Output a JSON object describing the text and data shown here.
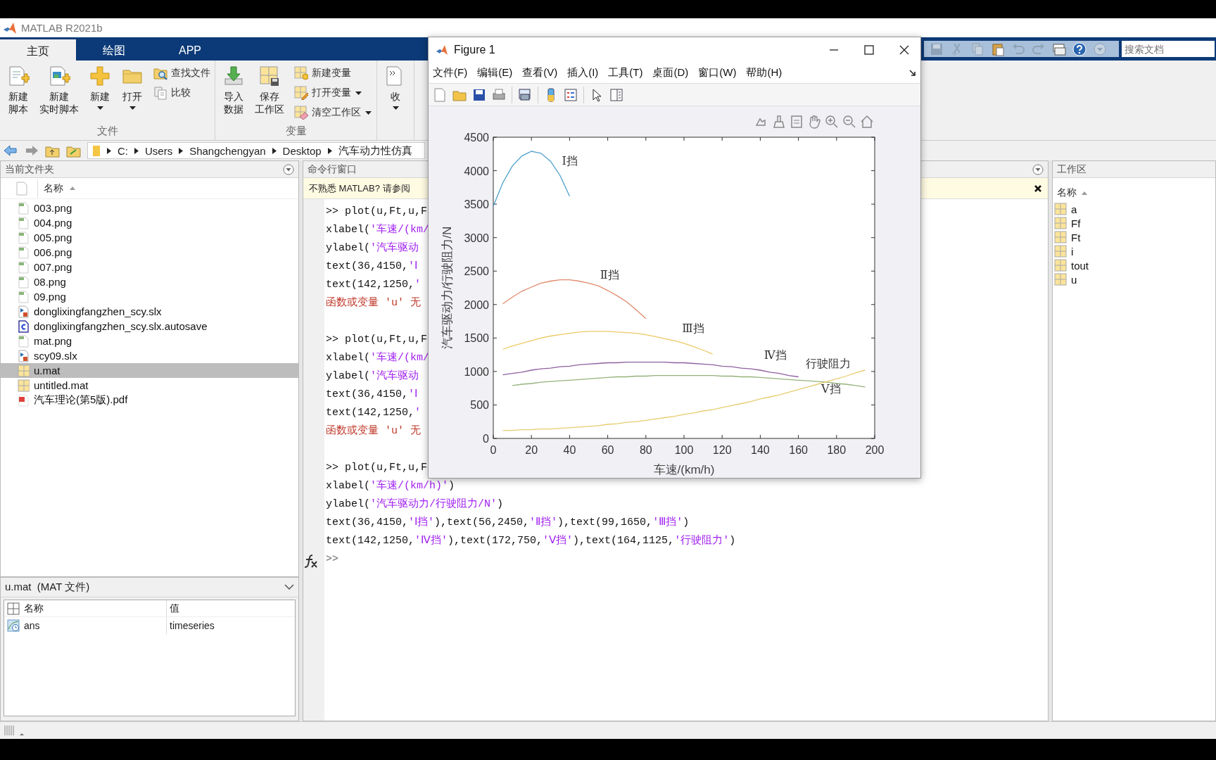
{
  "app": {
    "title": "MATLAB R2021b"
  },
  "ribbon": {
    "tabs": [
      {
        "label": "主页",
        "selected": true
      },
      {
        "label": "绘图",
        "selected": false
      },
      {
        "label": "APP",
        "selected": false
      }
    ],
    "groups": [
      {
        "label": "文件",
        "buttons": [
          {
            "kind": "large",
            "label": [
              "新建",
              "脚本"
            ],
            "dropdown": false
          },
          {
            "kind": "large",
            "label": [
              "新建",
              "实时脚本"
            ],
            "dropdown": false
          },
          {
            "kind": "large",
            "label": [
              "新建"
            ],
            "dropdown": true
          },
          {
            "kind": "large",
            "label": [
              "打开"
            ],
            "dropdown": true
          },
          {
            "kind": "small",
            "label": "查找文件",
            "dropdown": false
          },
          {
            "kind": "small",
            "label": "比较",
            "dropdown": false
          }
        ]
      },
      {
        "label": "变量",
        "buttons": [
          {
            "kind": "large",
            "label": [
              "导入",
              "数据"
            ],
            "dropdown": false
          },
          {
            "kind": "large",
            "label": [
              "保存",
              "工作区"
            ],
            "dropdown": false
          },
          {
            "kind": "small",
            "label": "新建变量",
            "dropdown": false
          },
          {
            "kind": "small",
            "label": "打开变量",
            "dropdown": true
          },
          {
            "kind": "small",
            "label": "清空工作区",
            "dropdown": true
          }
        ]
      },
      {
        "buttons": [
          {
            "kind": "large",
            "label": [
              "收"
            ],
            "dropdown": true
          }
        ]
      }
    ],
    "search": {
      "placeholder": "搜索文档"
    }
  },
  "address_bar": {
    "path": [
      "C:",
      "Users",
      "Shangchengyan",
      "Desktop",
      "汽车动力性仿真"
    ]
  },
  "file_browser": {
    "title": "当前文件夹",
    "column": "名称",
    "files": [
      {
        "name": "003.png",
        "kind": "png",
        "selected": false
      },
      {
        "name": "004.png",
        "kind": "png",
        "selected": false
      },
      {
        "name": "005.png",
        "kind": "png",
        "selected": false
      },
      {
        "name": "006.png",
        "kind": "png",
        "selected": false
      },
      {
        "name": "007.png",
        "kind": "png",
        "selected": false
      },
      {
        "name": "08.png",
        "kind": "png",
        "selected": false
      },
      {
        "name": "09.png",
        "kind": "png",
        "selected": false
      },
      {
        "name": "donglixingfangzhen_scy.slx",
        "kind": "slx",
        "selected": false
      },
      {
        "name": "donglixingfangzhen_scy.slx.autosave",
        "kind": "autosave",
        "selected": false
      },
      {
        "name": "mat.png",
        "kind": "png",
        "selected": false
      },
      {
        "name": "scy09.slx",
        "kind": "slx",
        "selected": false
      },
      {
        "name": "u.mat",
        "kind": "mat",
        "selected": true
      },
      {
        "name": "untitled.mat",
        "kind": "mat",
        "selected": false
      },
      {
        "name": "汽车理论(第5版).pdf",
        "kind": "pdf",
        "selected": false
      }
    ]
  },
  "details": {
    "title": "u.mat  (MAT 文件)",
    "columns": [
      "名称",
      "值"
    ],
    "rows": [
      {
        "name": "ans",
        "value": "timeseries"
      }
    ]
  },
  "command_window": {
    "title": "命令行窗口",
    "banner": "不熟悉 MATLAB? 请参阅",
    "blocks": [
      [
        {
          "segments": [
            {
              "kind": "code",
              "text": ">> plot(u,Ft,u,F"
            }
          ]
        },
        {
          "segments": [
            {
              "kind": "code",
              "text": "xlabel("
            },
            {
              "kind": "string",
              "text": "'车速/(km/"
            }
          ]
        },
        {
          "segments": [
            {
              "kind": "code",
              "text": "ylabel("
            },
            {
              "kind": "string",
              "text": "'汽车驱动"
            }
          ]
        },
        {
          "segments": [
            {
              "kind": "code",
              "text": "text(36,4150,"
            },
            {
              "kind": "string",
              "text": "'Ⅰ"
            }
          ]
        },
        {
          "segments": [
            {
              "kind": "code",
              "text": "text(142,1250,"
            },
            {
              "kind": "string",
              "text": "'"
            }
          ]
        },
        {
          "segments": [
            {
              "kind": "error",
              "text": "函数或变量 'u' 无"
            }
          ]
        }
      ],
      [
        {
          "segments": [
            {
              "kind": "code",
              "text": ">> plot(u,Ft,u,F"
            }
          ]
        },
        {
          "segments": [
            {
              "kind": "code",
              "text": "xlabel("
            },
            {
              "kind": "string",
              "text": "'车速/(km/"
            }
          ]
        },
        {
          "segments": [
            {
              "kind": "code",
              "text": "ylabel("
            },
            {
              "kind": "string",
              "text": "'汽车驱动"
            }
          ]
        },
        {
          "segments": [
            {
              "kind": "code",
              "text": "text(36,4150,"
            },
            {
              "kind": "string",
              "text": "'Ⅰ"
            }
          ]
        },
        {
          "segments": [
            {
              "kind": "code",
              "text": "text(142,1250,"
            },
            {
              "kind": "string",
              "text": "'"
            }
          ]
        },
        {
          "segments": [
            {
              "kind": "error",
              "text": "函数或变量 'u' 无"
            }
          ]
        }
      ],
      [
        {
          "segments": [
            {
              "kind": "code",
              "text": ">> plot(u,Ft,u,F"
            }
          ]
        },
        {
          "segments": [
            {
              "kind": "code",
              "text": "xlabel("
            },
            {
              "kind": "string",
              "text": "'车速/(km/h)'"
            },
            {
              "kind": "code",
              "text": ")"
            }
          ]
        },
        {
          "segments": [
            {
              "kind": "code",
              "text": "ylabel("
            },
            {
              "kind": "string",
              "text": "'汽车驱动力/行驶阻力/N'"
            },
            {
              "kind": "code",
              "text": ")"
            }
          ]
        },
        {
          "segments": [
            {
              "kind": "code",
              "text": "text(36,4150,"
            },
            {
              "kind": "string",
              "text": "'Ⅰ挡'"
            },
            {
              "kind": "code",
              "text": "),text(56,2450,"
            },
            {
              "kind": "string",
              "text": "'Ⅱ挡'"
            },
            {
              "kind": "code",
              "text": "),text(99,1650,"
            },
            {
              "kind": "string",
              "text": "'Ⅲ挡'"
            },
            {
              "kind": "code",
              "text": ")"
            }
          ]
        },
        {
          "segments": [
            {
              "kind": "code",
              "text": "text(142,1250,"
            },
            {
              "kind": "string",
              "text": "'Ⅳ挡'"
            },
            {
              "kind": "code",
              "text": "),text(172,750,"
            },
            {
              "kind": "string",
              "text": "'Ⅴ挡'"
            },
            {
              "kind": "code",
              "text": "),text(164,1125,"
            },
            {
              "kind": "string",
              "text": "'行驶阻力'"
            },
            {
              "kind": "code",
              "text": ")"
            }
          ]
        }
      ]
    ],
    "prompt": ">>"
  },
  "workspace": {
    "title": "工作区",
    "column": "名称",
    "variables": [
      "a",
      "Ff",
      "Ft",
      "i",
      "tout",
      "u"
    ]
  },
  "figure": {
    "title": "Figure 1",
    "menu": [
      "文件(F)",
      "编辑(E)",
      "查看(V)",
      "插入(I)",
      "工具(T)",
      "桌面(D)",
      "窗口(W)",
      "帮助(H)"
    ],
    "chart_data": {
      "type": "line",
      "xlabel": "车速/(km/h)",
      "ylabel": "汽车驱动力/行驶阻力/N",
      "x": [
        0,
        5,
        10,
        15,
        20,
        25,
        30,
        35,
        40,
        45,
        50,
        55,
        60,
        65,
        70,
        75,
        80,
        85,
        90,
        95,
        100,
        105,
        110,
        115,
        120,
        125,
        130,
        135,
        140,
        145,
        150,
        155,
        160,
        165,
        170,
        175,
        180,
        185,
        190,
        195
      ],
      "series": [
        {
          "color": "#4fa0cc",
          "values": [
            3470,
            3820,
            4070,
            4220,
            4290,
            4260,
            4140,
            3930,
            3620,
            null,
            null,
            null,
            null,
            null,
            null,
            null,
            null,
            null,
            null,
            null,
            null,
            null,
            null,
            null,
            null,
            null,
            null,
            null,
            null,
            null,
            null,
            null,
            null,
            null,
            null,
            null,
            null,
            null,
            null,
            null
          ]
        },
        {
          "color": "#e08a6c",
          "values": [
            null,
            2010,
            2110,
            2200,
            2260,
            2320,
            2350,
            2370,
            2370,
            2350,
            2320,
            2280,
            2210,
            2130,
            2040,
            1920,
            1790,
            null,
            null,
            null,
            null,
            null,
            null,
            null,
            null,
            null,
            null,
            null,
            null,
            null,
            null,
            null,
            null,
            null,
            null,
            null,
            null,
            null,
            null,
            null
          ]
        },
        {
          "color": "#ecc865",
          "values": [
            null,
            1330,
            1380,
            1420,
            1460,
            1500,
            1530,
            1550,
            1570,
            1590,
            1600,
            1600,
            1600,
            1590,
            1580,
            1570,
            1550,
            1520,
            1490,
            1460,
            1420,
            1370,
            1320,
            1260,
            null,
            null,
            null,
            null,
            null,
            null,
            null,
            null,
            null,
            null,
            null,
            null,
            null,
            null,
            null,
            null
          ]
        },
        {
          "color": "#8e5f9e",
          "values": [
            null,
            950,
            970,
            990,
            1020,
            1040,
            1050,
            1070,
            1080,
            1100,
            1110,
            1120,
            1130,
            1130,
            1140,
            1140,
            1140,
            1140,
            1140,
            1130,
            1130,
            1120,
            1110,
            1100,
            1080,
            1070,
            1050,
            1040,
            1020,
            990,
            970,
            940,
            920,
            null,
            null,
            null,
            null,
            null,
            null,
            null
          ]
        },
        {
          "color": "#95b27a",
          "values": [
            null,
            null,
            790,
            810,
            820,
            840,
            850,
            860,
            870,
            880,
            890,
            900,
            910,
            920,
            920,
            930,
            930,
            940,
            940,
            940,
            940,
            940,
            940,
            940,
            930,
            930,
            920,
            920,
            910,
            900,
            890,
            880,
            870,
            860,
            850,
            840,
            820,
            810,
            790,
            770
          ]
        },
        {
          "color": "#e6cc6e",
          "values": [
            null,
            120,
            120,
            130,
            130,
            140,
            140,
            150,
            160,
            170,
            180,
            190,
            210,
            220,
            240,
            250,
            270,
            290,
            310,
            330,
            360,
            380,
            410,
            430,
            460,
            490,
            520,
            550,
            590,
            620,
            650,
            690,
            730,
            770,
            810,
            850,
            890,
            930,
            980,
            1020
          ]
        }
      ],
      "xlim": [
        0,
        200
      ],
      "ylim": [
        0,
        4500
      ],
      "xticks": [
        0,
        20,
        40,
        60,
        80,
        100,
        120,
        140,
        160,
        180,
        200
      ],
      "yticks": [
        0,
        500,
        1000,
        1500,
        2000,
        2500,
        3000,
        3500,
        4000,
        4500
      ],
      "annotations": [
        "Ⅰ挡",
        "Ⅱ挡",
        "Ⅲ挡",
        "Ⅳ挡",
        "Ⅴ挡",
        "行驶阻力"
      ]
    }
  }
}
